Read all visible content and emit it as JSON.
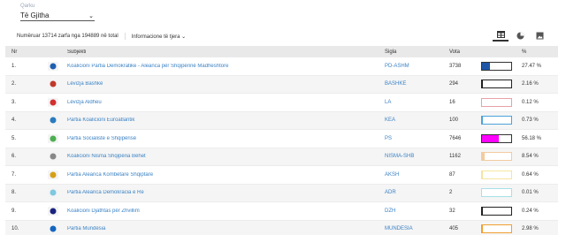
{
  "filter": {
    "label": "Qarku",
    "value": "Të Gjitha"
  },
  "info": {
    "counted": "Numëruar 13714 zarfa nga 194889 në total",
    "more_label": "Informacione të tjera"
  },
  "view_buttons": [
    {
      "name": "table-view-icon",
      "active": true
    },
    {
      "name": "pie-chart-icon",
      "active": false
    },
    {
      "name": "image-icon",
      "active": false
    }
  ],
  "table": {
    "headers": {
      "nr": "Nr",
      "subjekti": "Subjekti",
      "sigla": "Sigla",
      "vota": "Vota",
      "pct": "%"
    },
    "rows": [
      {
        "nr": "1.",
        "subjekti": "Koalicioni Partia Demokratike - Aleanca për Shqipërinë Madheshtore",
        "sigla": "PD-ASHM",
        "vota": "3738",
        "pct": "27.47 %",
        "share": 0.2747,
        "color": "#1f57a8",
        "border": "#333333",
        "logo_color": "#1f5fb0"
      },
      {
        "nr": "2.",
        "subjekti": "Lëvizja Bashkë",
        "sigla": "BASHKE",
        "vota": "294",
        "pct": "2.16 %",
        "share": 0.0216,
        "color": "#222222",
        "border": "#222222",
        "logo_color": "#c0392b"
      },
      {
        "nr": "3.",
        "subjekti": "Lëvizja Aldheu",
        "sigla": "LA",
        "vota": "16",
        "pct": "0.12 %",
        "share": 0.0012,
        "color": "#e8a0a8",
        "border": "#e8a0a8",
        "logo_color": "#d32f2f"
      },
      {
        "nr": "4.",
        "subjekti": "Partia Koalicioni Euroatlantik",
        "sigla": "KEA",
        "vota": "100",
        "pct": "0.73 %",
        "share": 0.0073,
        "color": "#4aa3d8",
        "border": "#4aa3d8",
        "logo_color": "#2a7bbf"
      },
      {
        "nr": "5.",
        "subjekti": "Partia Socialiste e Shqipërisë",
        "sigla": "PS",
        "vota": "7646",
        "pct": "56.18 %",
        "share": 0.5618,
        "color": "#ff00ff",
        "border": "#333333",
        "logo_color": "#4caf50"
      },
      {
        "nr": "6.",
        "subjekti": "Koalicioni Nisma Shqipëria Bëhet",
        "sigla": "NISMA-SHB",
        "vota": "1162",
        "pct": "8.54 %",
        "share": 0.0854,
        "color": "#f3cba0",
        "border": "#f3cba0",
        "logo_color": "#888888"
      },
      {
        "nr": "7.",
        "subjekti": "Partia Aleanca Kombëtare Shqiptare",
        "sigla": "AKSH",
        "vota": "87",
        "pct": "0.64 %",
        "share": 0.0064,
        "color": "#f5e5a0",
        "border": "#f5e5a0",
        "logo_color": "#d4a017"
      },
      {
        "nr": "8.",
        "subjekti": "Partia Aleanca Demokracia e Re",
        "sigla": "ADR",
        "vota": "2",
        "pct": "0.01 %",
        "share": 0.0001,
        "color": "#a8e0e8",
        "border": "#a8e0e8",
        "logo_color": "#7fc8e0"
      },
      {
        "nr": "9.",
        "subjekti": "Koalicioni Djathtas për Zhvillim",
        "sigla": "DZH",
        "vota": "32",
        "pct": "0.24 %",
        "share": 0.0024,
        "color": "#222222",
        "border": "#222222",
        "logo_color": "#1a237e"
      },
      {
        "nr": "10.",
        "subjekti": "Partia Mundësia",
        "sigla": "MUNDESIA",
        "vota": "405",
        "pct": "2.98 %",
        "share": 0.0298,
        "color": "#f0a030",
        "border": "#f0a030",
        "logo_color": "#1565c0"
      }
    ]
  }
}
